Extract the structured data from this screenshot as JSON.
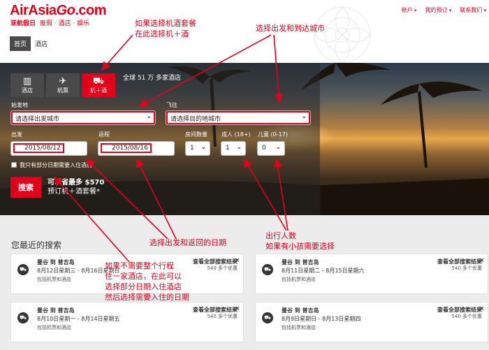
{
  "brand": {
    "logo_main": "AirAsia",
    "logo_go": "Go",
    "logo_tld": ".com",
    "logo_cn": "亚航假日",
    "tagline": "度假 · 酒店 · 娱乐",
    "color": "#e3001b"
  },
  "toplinks": {
    "account": "帐户",
    "bookings": "我的预订",
    "contact": "联系我们"
  },
  "subnav": {
    "home": "首页",
    "hotel": "酒店"
  },
  "tabs": [
    {
      "label": "酒店",
      "icon": "hotel-icon"
    },
    {
      "label": "机票",
      "icon": "plane-icon"
    },
    {
      "label": "机＋酒",
      "icon": "flight-hotel-icon"
    }
  ],
  "tab_note": "全球 51 万 多家酒店",
  "form": {
    "from_label": "始发地",
    "from_value": "请选择出发城市",
    "to_label": "飞往",
    "to_value": "请选择目的地城市",
    "depart_label": "出发",
    "depart_value": "2015/08/12",
    "return_label": "返程",
    "return_value": "2015/08/16",
    "rooms_label": "房间数量",
    "rooms_value": "1",
    "adults_label": "成人 (18+)",
    "adults_value": "1",
    "children_label": "儿童 (0-17)",
    "children_value": "0",
    "partial_hotel_label": "我只有部分日期需要入住酒店",
    "search_button": "搜索",
    "save_line1": "可以省最多 $570",
    "save_line2": "预订机＋酒套餐*"
  },
  "recent": {
    "title": "您最近的搜索",
    "cards": [
      {
        "route": "曼谷 到 普吉岛",
        "dates": "8月12日星期三 - 8月16日星期日",
        "includes": "包括机票和酒店",
        "view_all": "查看全部搜索结果",
        "offers": "540 多个优惠"
      },
      {
        "route": "曼谷 到 普吉岛",
        "dates": "8月11日星期二 - 8月15日星期六",
        "includes": "包括机票和酒店",
        "view_all": "查看全部搜索结果",
        "offers": "540 多个优惠"
      },
      {
        "route": "曼谷 到 普吉岛",
        "dates": "8月10日星期一 - 8月14日星期五",
        "includes": "包括机票和酒店",
        "view_all": "查看全部搜索结果",
        "offers": "540 多个优惠"
      },
      {
        "route": "曼谷 到 普吉岛",
        "dates": "8月9日星期日 - 8月13日星期四",
        "includes": "包括机票和酒店",
        "view_all": "查看全部搜索结果",
        "offers": "540 多个优惠"
      }
    ],
    "close": "×"
  },
  "annotations": {
    "a1_line1": "如果选择机酒套餐",
    "a1_line2": "在此选择机＋酒",
    "a2": "选择出发和到达城市",
    "a3": "选择出发和返回的日期",
    "a4_line1": "出行人数",
    "a4_line2": "如果有小孩需要选择",
    "a5_line1": "如果不需要整个行程",
    "a5_line2": "住一家酒店，在此可以",
    "a5_line3": "选择部分日期入住酒店",
    "a5_line4": "然后选择需要入住的日期"
  }
}
